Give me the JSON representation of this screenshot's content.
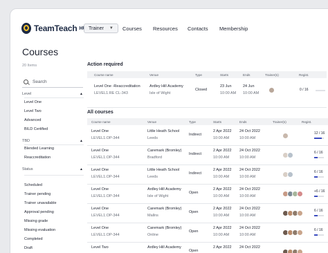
{
  "header": {
    "logo_text": "TeamTeach",
    "logo_hub": "HUB",
    "role": "Trainer",
    "nav": [
      "Courses",
      "Resources",
      "Contacts",
      "Membership"
    ]
  },
  "page": {
    "title": "Courses",
    "items_count": "20 Items"
  },
  "sidebar": {
    "search_placeholder": "Search",
    "level_label": "Level",
    "level_options": [
      "Level One",
      "Level Two",
      "Advanced",
      "BILD Certified"
    ],
    "tbd_label": "TBD",
    "tbd_options": [
      "Blended Learning",
      "Reaccreditation"
    ],
    "status_label": "Status",
    "status_options": [
      "Scheduled",
      "Trainer pending",
      "Trainer unavailable",
      "Approval pending",
      "Missing grade",
      "Missing evaluation",
      "Completed",
      "Draft"
    ]
  },
  "action_required": {
    "title": "Action required",
    "headers": [
      "Course name",
      "Venue",
      "Type",
      "Starts",
      "Ends",
      "Trainer(s)",
      "Regist."
    ],
    "rows": [
      {
        "name": "Level One -Reaccreditation",
        "code": "LEVEL1.RE CL-343",
        "venue": "Ardley Hill Academy",
        "venue_sub": "Isle of Wight",
        "type": "Closed",
        "start_date": "23 Jun",
        "start_time": "10:00 AM",
        "end_date": "24 Jun",
        "end_time": "10:00 AM",
        "regist": "0 / 16",
        "fill": 0
      }
    ]
  },
  "all_courses": {
    "title": "All courses",
    "headers": [
      "Course name",
      "Venue",
      "Type",
      "Starts",
      "Ends",
      "Trainer(s)",
      "Regist."
    ],
    "rows": [
      {
        "name": "Level One",
        "code": "LEVEL1.OP-344",
        "venue": "Little Heath School",
        "venue_sub": "Leeds",
        "type": "Indirect",
        "start_date": "2 Apr 2022",
        "start_time": "10:00 AM",
        "end_date": "24 Oct 2022",
        "end_time": "10:00 AM",
        "regist": "12 / 16",
        "fill": 0.75
      },
      {
        "name": "Level One",
        "code": "LEVEL1.OP-344",
        "venue": "Caremark (Bromley)",
        "venue_sub": "Bradford",
        "type": "Indirect",
        "start_date": "2 Apr 2022",
        "start_time": "10:00 AM",
        "end_date": "24 Oct 2022",
        "end_time": "10:00 AM",
        "regist": "6 / 16",
        "fill": 0.375
      },
      {
        "name": "Level One",
        "code": "LEVEL1.OP-344",
        "venue": "Little Heath School",
        "venue_sub": "Leeds",
        "type": "Indirect",
        "start_date": "2 Apr 2022",
        "start_time": "10:00 AM",
        "end_date": "24 Oct 2022",
        "end_time": "10:00 AM",
        "regist": "6 / 16",
        "fill": 0.375
      },
      {
        "name": "Level One",
        "code": "LEVEL1.OP-344",
        "venue": "Ardley Hill Academy",
        "venue_sub": "Isle of Wight",
        "type": "Open",
        "start_date": "2 Apr 2022",
        "start_time": "10:00 AM",
        "end_date": "24 Oct 2022",
        "end_time": "10:00 AM",
        "regist": "+6 / 16",
        "fill": 0.375
      },
      {
        "name": "Level One",
        "code": "LEVEL1.OP-344",
        "venue": "Caremark (Bromley)",
        "venue_sub": "Mallns",
        "type": "Open",
        "start_date": "2 Apr 2022",
        "start_time": "10:00 AM",
        "end_date": "24 Oct 2022",
        "end_time": "10:00 AM",
        "regist": "6 / 16",
        "fill": 0.375
      },
      {
        "name": "Level One",
        "code": "LEVEL1.OP-344",
        "venue": "Caremark (Bromley)",
        "venue_sub": "Online",
        "type": "Open",
        "start_date": "2 Apr 2022",
        "start_time": "10:00 AM",
        "end_date": "24 Oct 2022",
        "end_time": "10:00 AM",
        "regist": "6 / 16",
        "fill": 0.375
      },
      {
        "name": "Level Two",
        "code": "",
        "venue": "Ardley Hill Academy",
        "venue_sub": "",
        "type": "Open",
        "start_date": "2 Apr 2022",
        "start_time": "",
        "end_date": "24 Oct 2022",
        "end_time": "",
        "regist": "",
        "fill": 0
      }
    ]
  },
  "colors": {
    "accent": "#3b4cc0",
    "brand": "#1d2a44",
    "logo_yellow": "#f4c22b",
    "status_green": "#48b06a",
    "status_amber": "#e9a53a"
  }
}
